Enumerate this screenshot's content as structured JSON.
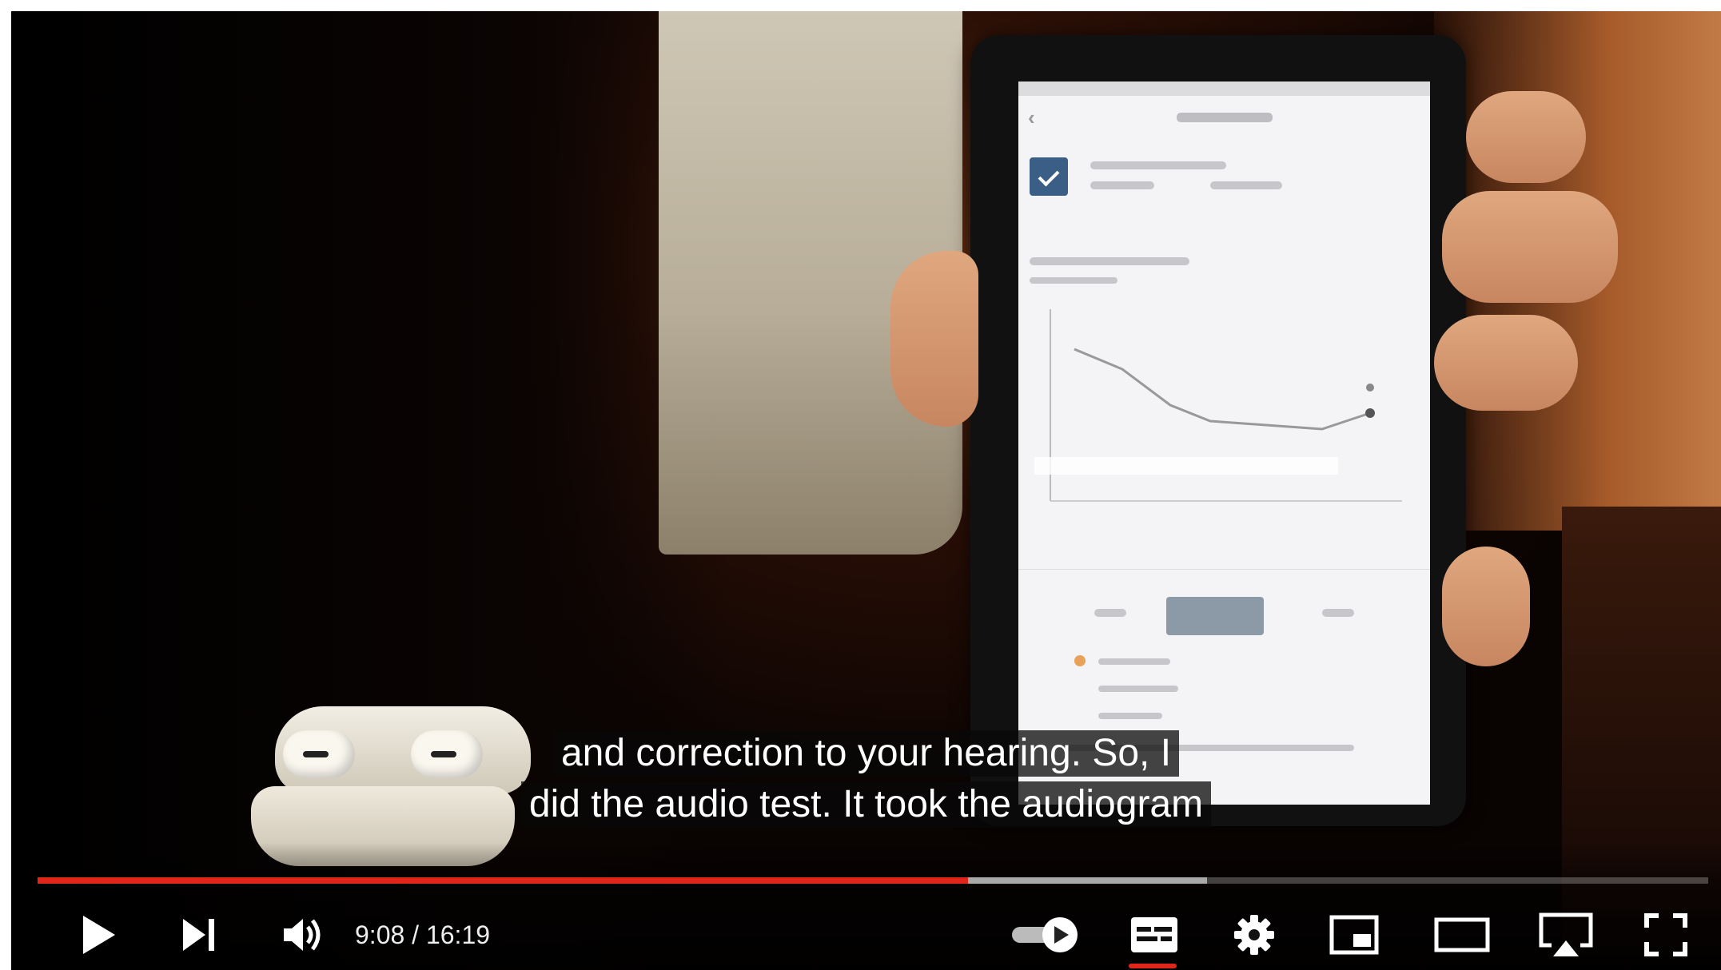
{
  "player": {
    "captions": [
      "and correction to your hearing. So, I",
      "did the audio test. It took the audiogram"
    ],
    "time_display": "9:08 / 16:19",
    "progress_played": 0.557,
    "progress_loaded": 0.7,
    "accent_color": "#e0251b",
    "controls": {
      "play": "play-icon",
      "next": "next-icon",
      "volume": "volume-icon",
      "autoplay": "autoplay-toggle-icon",
      "subtitles": "subtitles-icon",
      "settings": "gear-icon",
      "miniplayer": "miniplayer-icon",
      "theater": "theater-mode-icon",
      "airplay": "airplay-icon",
      "fullscreen": "fullscreen-icon"
    }
  }
}
